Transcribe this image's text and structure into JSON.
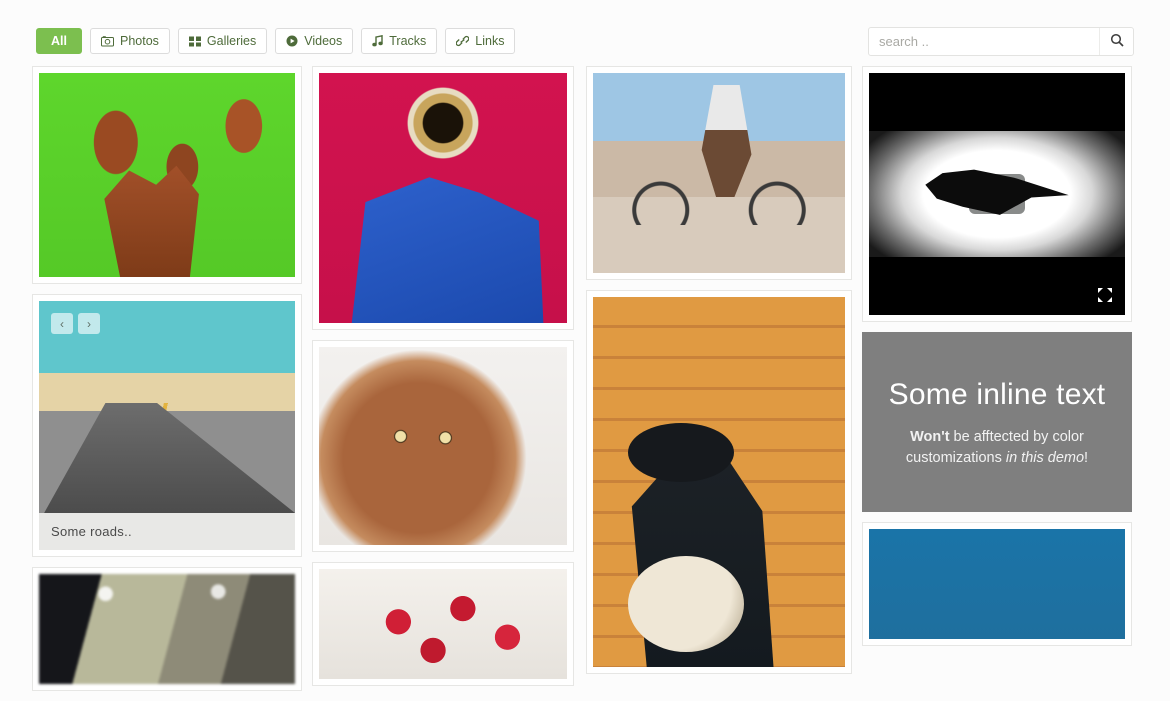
{
  "toolbar": {
    "filters": [
      {
        "label": "All",
        "icon": "none",
        "active": true
      },
      {
        "label": "Photos",
        "icon": "camera-icon",
        "active": false
      },
      {
        "label": "Galleries",
        "icon": "grid-icon",
        "active": false
      },
      {
        "label": "Videos",
        "icon": "play-circle-icon",
        "active": false
      },
      {
        "label": "Tracks",
        "icon": "music-note-icon",
        "active": false
      },
      {
        "label": "Links",
        "icon": "link-icon",
        "active": false
      }
    ],
    "search": {
      "value": "",
      "placeholder": "search ..",
      "icon": "search-icon"
    }
  },
  "theme": {
    "accent": "#7cbf4f",
    "background": "#fcfcfc",
    "card_border": "#e6e6e4",
    "caption_background": "#e8e8e6",
    "text_panel_background": "#7f7f7f"
  },
  "grid": {
    "columns": [
      {
        "name": "column-1",
        "items": [
          {
            "type": "photo",
            "name": "rusty-shapes-on-green",
            "caption": null
          },
          {
            "type": "gallery",
            "name": "desert-road",
            "caption": "Some roads..",
            "carousel": {
              "prev": "‹",
              "next": "›"
            }
          },
          {
            "type": "photo",
            "name": "blurred-desk-hands",
            "caption": null
          }
        ]
      },
      {
        "name": "column-2",
        "items": [
          {
            "type": "photo",
            "name": "trumpet-player-red",
            "caption": null
          },
          {
            "type": "photo",
            "name": "brown-dog-portrait",
            "caption": null
          },
          {
            "type": "photo",
            "name": "raspberries-bowl",
            "caption": null
          }
        ]
      },
      {
        "name": "column-3",
        "items": [
          {
            "type": "photo",
            "name": "cyclist-on-bridge",
            "caption": null
          },
          {
            "type": "photo",
            "name": "banjo-player-wood-wall",
            "caption": null
          }
        ]
      },
      {
        "name": "column-4",
        "items": [
          {
            "type": "video",
            "name": "black-bird-video",
            "controls": {
              "play": "play-icon",
              "fullscreen": "fullscreen-icon"
            }
          },
          {
            "type": "text",
            "name": "inline-text-panel",
            "heading": "Some inline text",
            "body": {
              "strong": "Won't",
              "mid": " be afftected by color customizations ",
              "em": "in this demo",
              "tail": "!"
            }
          },
          {
            "type": "photo",
            "name": "blue-sky",
            "caption": null
          }
        ]
      }
    ]
  }
}
